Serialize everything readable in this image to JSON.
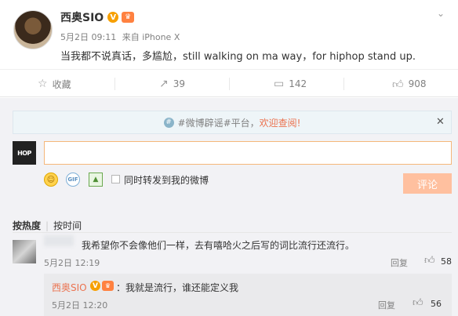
{
  "post": {
    "author": "西奥SIO",
    "v_badge": "V",
    "level_badge": "♛",
    "date": "5月2日 09:11",
    "source": "来自 iPhone X",
    "text": "当我都不说真话，多尴尬，still walking on ma way，for hiphop stand up."
  },
  "actions": {
    "favorite": "收藏",
    "forward": "39",
    "comment": "142",
    "like": "908"
  },
  "notice": {
    "prefix": "#微博辟谣#平台，",
    "link": "欢迎查阅!"
  },
  "composer": {
    "my_avatar_text": "HOP",
    "input_value": "",
    "input_placeholder": "",
    "forward_label": "同时转发到我的微博",
    "submit_label": "评论"
  },
  "sort": {
    "hot": "按热度",
    "time": "按时间"
  },
  "comment": {
    "text": "我希望你不会像他们一样，去有嘻哈火之后写的词比流行还流行。",
    "time": "5月2日 12:19",
    "reply_label": "回复",
    "like_count": "58"
  },
  "reply": {
    "author": "西奥SIO",
    "v_badge": "V",
    "level_badge": "♛",
    "text": "：我就是流行，谁还能定义我",
    "time": "5月2日 12:20",
    "reply_label": "回复",
    "like_count": "56"
  },
  "colors": {
    "accent": "#eb7350",
    "submit_disabled": "#ffc09f",
    "input_border": "#f5b77a"
  }
}
